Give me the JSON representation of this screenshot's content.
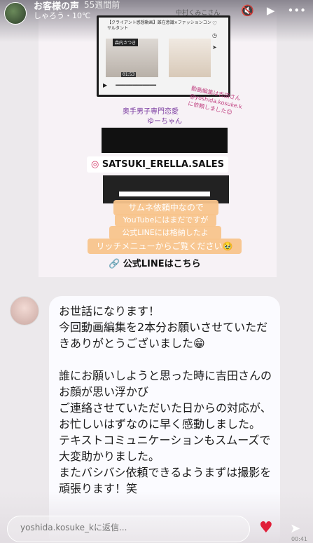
{
  "header": {
    "title": "お客様の声",
    "time": "55週間前",
    "music": "しゃろう・10℃"
  },
  "video": {
    "title": "【クライアント感想動画】誰在意識×ファッションコンサルタント",
    "name": "中村くみこさん",
    "tag": "森内さつき",
    "time": "01:53"
  },
  "overlay": {
    "label1": "奥手男子専門恋愛",
    "label2": "ゆーちゃん",
    "pink_note": "動画編集は吉田さん\n@yoshida.kosuke.k\nに依頼しました😊",
    "sticker": "SATSUKI_ERELLA.SALES",
    "orange1": "サムネ依頼中なので",
    "orange2": "YouTubeにはまだですが",
    "orange3": "公式LINEには格納したよ",
    "orange4": "リッチメニューからご覧ください🥹",
    "line_link": "公式LINEはこちら"
  },
  "comment": {
    "text": "お世話になります！\n今回動画編集を2本分お願いさせていただきありがとうございました😁\n\n誰にお願いしようと思った時に吉田さんのお顔が思い浮かび\nご連絡させていただいた日からの対応が、お忙しいはずなのに早く感動しました。\nテキストコミュニケーションもスムーズで大変助かりました。\nまたバシバシ依頼できるようまずは撮影を頑張ります！笑"
  },
  "reply": {
    "placeholder": "yoshida.kosuke_kに返信..."
  },
  "footer": {
    "timestamp": "00:41"
  },
  "colors": {
    "heart": "#e0203a",
    "sticker_icon": "#d4406e",
    "orange": "#f8c48c"
  }
}
